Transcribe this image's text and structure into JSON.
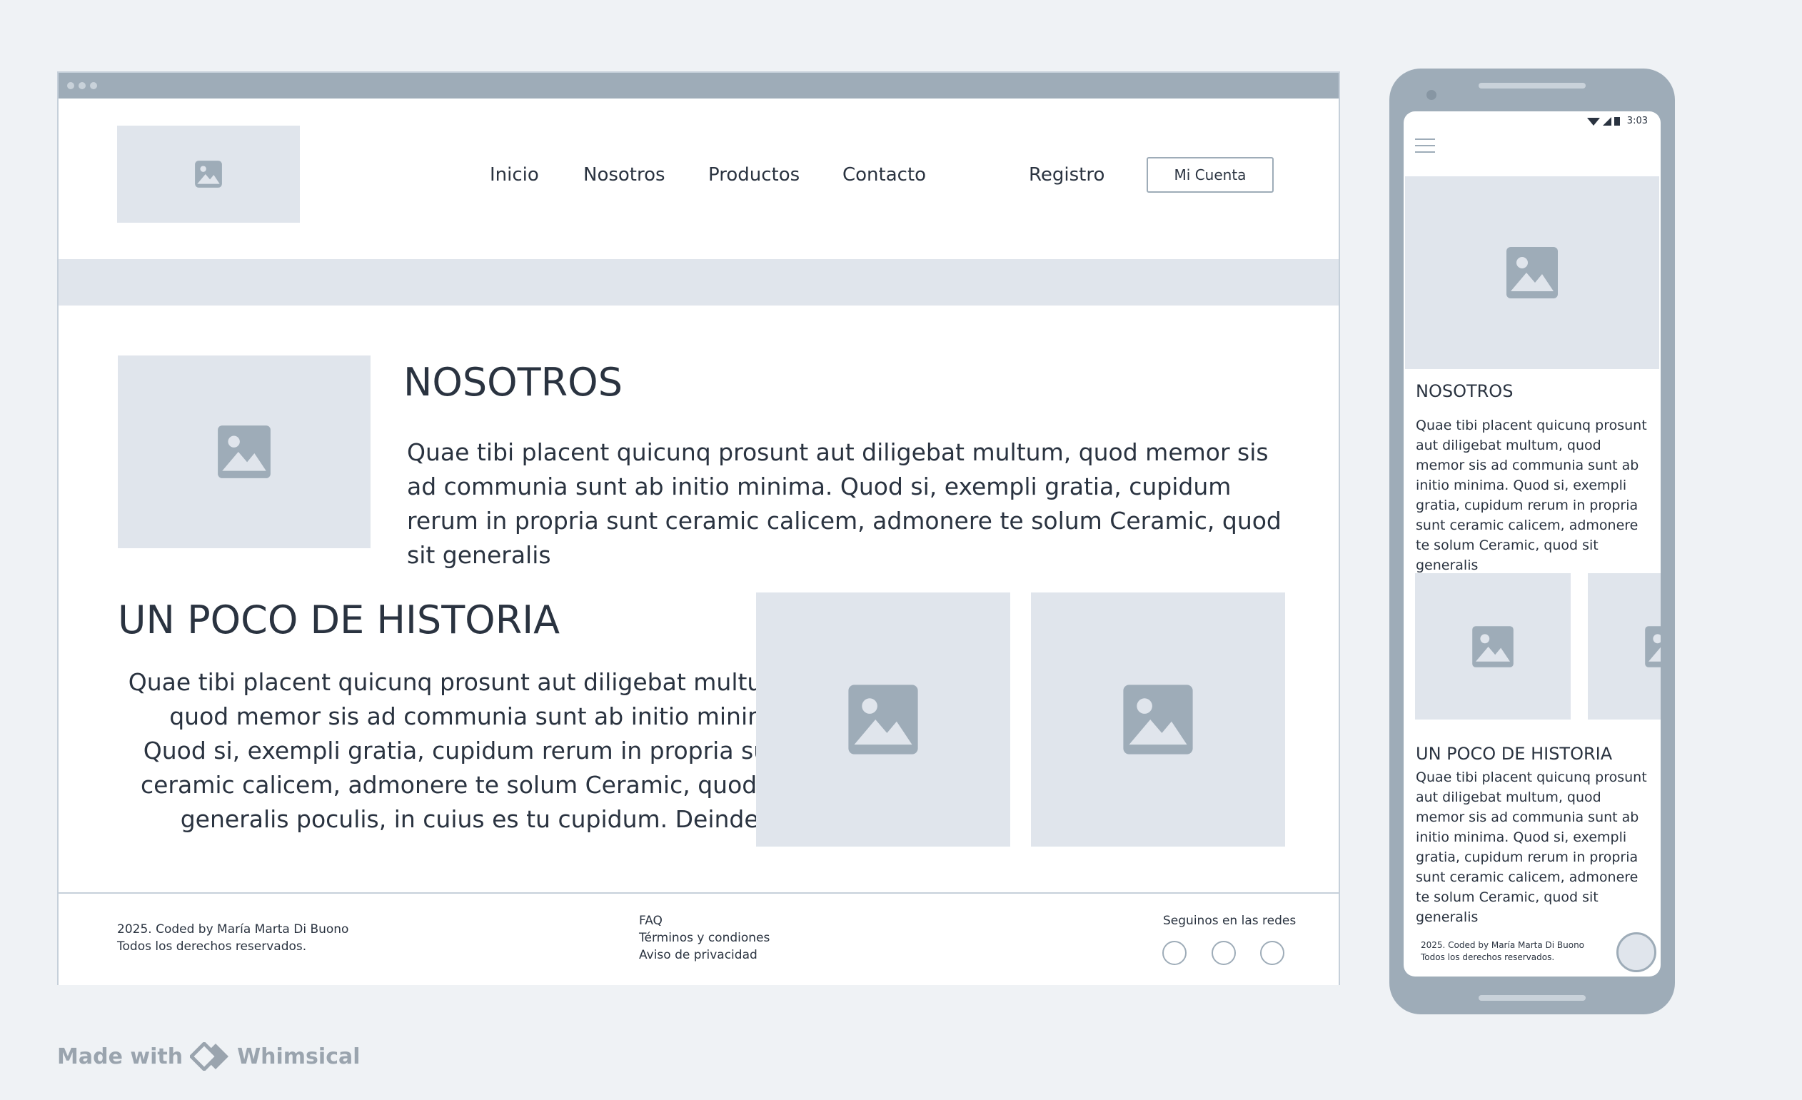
{
  "desktop": {
    "nav": {
      "links": [
        "Inicio",
        "Nosotros",
        "Productos",
        "Contacto"
      ],
      "register": "Registro",
      "account": "Mi Cuenta"
    },
    "about": {
      "title": "NOSOTROS",
      "text": "Quae tibi placent quicunq prosunt aut diligebat multum, quod memor sis ad communia sunt ab initio minima. Quod si, exempli gratia, cupidum rerum in propria sunt ceramic calicem, admonere te solum Ceramic, quod sit generalis"
    },
    "history": {
      "title": "UN POCO DE HISTORIA",
      "text": "Quae tibi placent quicunq prosunt aut diligebat multum, quod memor sis ad communia sunt ab initio minima. Quod si, exempli gratia, cupidum rerum in propria sunt ceramic calicem, admonere te solum Ceramic, quod sit generalis poculis, in cuius es tu cupidum. Deinde, si"
    },
    "footer": {
      "credit": "2025. Coded by María Marta Di Buono",
      "rights": "Todos los derechos reservados.",
      "links": [
        "FAQ",
        "Términos y condiones",
        "Aviso de privacidad"
      ],
      "social_title": "Seguinos en las redes"
    }
  },
  "mobile": {
    "status_time": "3:03",
    "about_title": "NOSOTROS",
    "about_text": "Quae tibi placent quicunq prosunt aut diligebat multum, quod memor sis ad communia sunt ab initio minima. Quod si, exempli gratia, cupidum rerum in propria sunt ceramic calicem, admonere te solum Ceramic, quod sit generalis",
    "history_title": "UN POCO DE HISTORIA",
    "history_text": "Quae tibi placent quicunq prosunt aut diligebat multum, quod memor sis ad communia sunt ab initio minima. Quod si, exempli gratia, cupidum rerum in propria sunt ceramic calicem, admonere te solum Ceramic, quod sit generalis",
    "footer_credit": "2025. Coded by María Marta Di Buono",
    "footer_rights": "Todos los derechos reservados."
  },
  "branding": {
    "made_with": "Made with",
    "tool": "Whimsical"
  },
  "colors": {
    "page_bg": "#eff2f5",
    "placeholder": "#e0e5ec",
    "icon": "#9eacb8",
    "text": "#2a3340"
  }
}
